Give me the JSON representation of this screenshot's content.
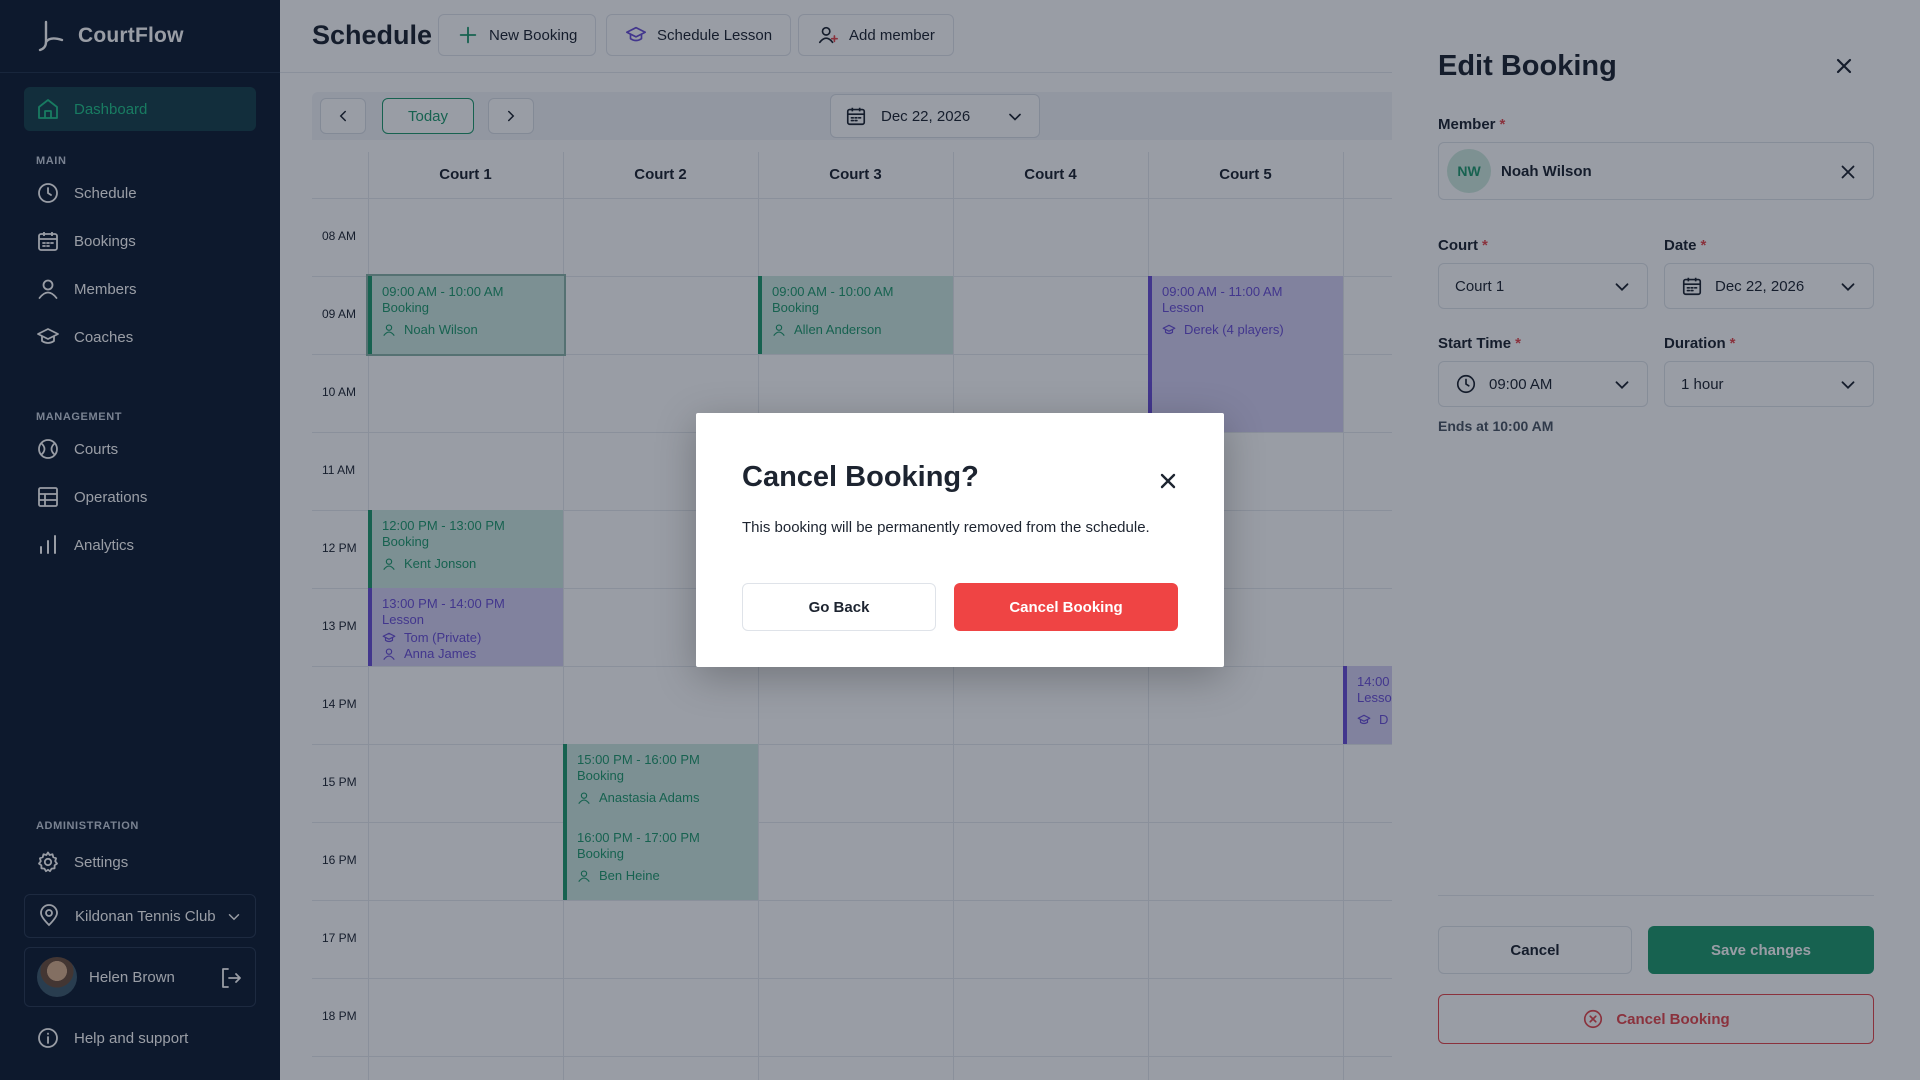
{
  "app": {
    "name": "CourtFlow"
  },
  "sidebar": {
    "dashboard": "Dashboard",
    "section_main": "MAIN",
    "schedule": "Schedule",
    "bookings": "Bookings",
    "members": "Members",
    "coaches": "Coaches",
    "section_management": "MANAGEMENT",
    "courts": "Courts",
    "operations": "Operations",
    "analytics": "Analytics",
    "section_administration": "ADMINISTRATION",
    "settings": "Settings",
    "club": "Kildonan Tennis Club",
    "user": "Helen Brown",
    "help": "Help and support"
  },
  "header": {
    "title": "Schedule",
    "new_booking": "New Booking",
    "schedule_lesson": "Schedule Lesson",
    "add_member": "Add member"
  },
  "toolbar": {
    "today": "Today",
    "date": "Dec 22, 2026"
  },
  "courts": [
    "Court 1",
    "Court 2",
    "Court 3",
    "Court 4",
    "Court 5"
  ],
  "times": [
    "08 AM",
    "09 AM",
    "10 AM",
    "11 AM",
    "12 PM",
    "13 PM",
    "14 PM",
    "15 PM",
    "16 PM",
    "17 PM",
    "18 PM"
  ],
  "events": {
    "e1": {
      "time": "09:00 AM - 10:00 AM",
      "type": "Booking",
      "person": "Noah Wilson"
    },
    "e2": {
      "time": "09:00 AM - 10:00 AM",
      "type": "Booking",
      "person": "Allen Anderson"
    },
    "e3": {
      "time": "09:00 AM - 11:00 AM",
      "type": "Lesson",
      "person": "Derek (4 players)"
    },
    "e4": {
      "time": "12:00 PM - 13:00 PM",
      "type": "Booking",
      "person": "Kent Jonson"
    },
    "e5": {
      "time": "13:00 PM - 14:00 PM",
      "type": "Lesson",
      "coach": "Tom (Private)",
      "person": "Anna James"
    },
    "e6": {
      "time": "15:00 PM - 16:00 PM",
      "type": "Booking",
      "person": "Anastasia Adams"
    },
    "e7": {
      "time": "16:00 PM - 17:00 PM",
      "type": "Booking",
      "person": "Ben Heine"
    },
    "e8": {
      "time": "14:00",
      "type": "Lesso",
      "person": "D"
    }
  },
  "panel": {
    "title": "Edit Booking",
    "member_label": "Member",
    "member_initials": "NW",
    "member_name": "Noah Wilson",
    "court_label": "Court",
    "court_value": "Court 1",
    "date_label": "Date",
    "date_value": "Dec 22, 2026",
    "start_label": "Start Time",
    "start_value": "09:00 AM",
    "duration_label": "Duration",
    "duration_value": "1 hour",
    "ends_text": "Ends at 10:00 AM",
    "cancel": "Cancel",
    "save": "Save changes",
    "cancel_booking": "Cancel Booking",
    "required_mark": "*"
  },
  "modal": {
    "title": "Cancel Booking?",
    "text": "This booking will be permanently removed from the schedule.",
    "back": "Go Back",
    "confirm": "Cancel Booking"
  },
  "colors": {
    "sidebar_bg": "#0e1c31",
    "accent_green": "#1f9a6d",
    "lesson_purple": "#6a4fd6",
    "danger_red": "#ef4444"
  }
}
